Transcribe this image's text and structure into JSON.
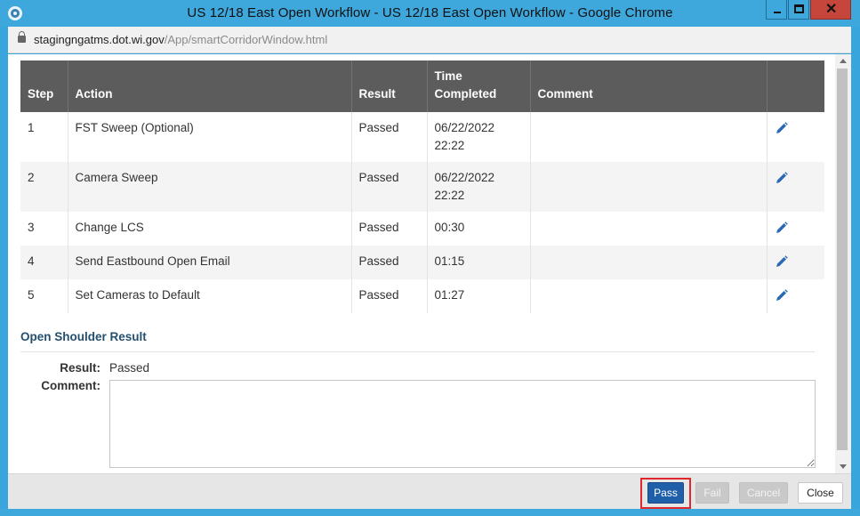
{
  "window": {
    "title": "US 12/18 East Open Workflow - US 12/18 East Open Workflow - Google Chrome"
  },
  "address": {
    "host": "stagingngatms.dot.wi.gov",
    "path": "/App/smartCorridorWindow.html"
  },
  "table": {
    "headers": {
      "step": "Step",
      "action": "Action",
      "result": "Result",
      "time_line1": "Time",
      "time_line2": "Completed",
      "comment": "Comment"
    },
    "rows": [
      {
        "step": "1",
        "action": "FST Sweep (Optional)",
        "result": "Passed",
        "time_line1": "06/22/2022",
        "time_line2": "22:22",
        "comment": ""
      },
      {
        "step": "2",
        "action": "Camera Sweep",
        "result": "Passed",
        "time_line1": "06/22/2022",
        "time_line2": "22:22",
        "comment": ""
      },
      {
        "step": "3",
        "action": "Change LCS",
        "result": "Passed",
        "time_line1": "00:30",
        "time_line2": "",
        "comment": ""
      },
      {
        "step": "4",
        "action": "Send Eastbound Open Email",
        "result": "Passed",
        "time_line1": "01:15",
        "time_line2": "",
        "comment": ""
      },
      {
        "step": "5",
        "action": "Set Cameras to Default",
        "result": "Passed",
        "time_line1": "01:27",
        "time_line2": "",
        "comment": ""
      }
    ],
    "edit_icon": "pencil-icon"
  },
  "result_section": {
    "title": "Open Shoulder Result",
    "result_label": "Result:",
    "result_value": "Passed",
    "comment_label": "Comment:",
    "comment_value": ""
  },
  "footer": {
    "pass_label": "Pass",
    "fail_label": "Fail",
    "cancel_label": "Cancel",
    "close_label": "Close"
  },
  "colors": {
    "window_frame": "#3ea8dc",
    "table_header": "#5c5c5c",
    "section_title": "#244f6f",
    "pass_button": "#1f5ea8",
    "highlight": "#e0262e",
    "edit_icon": "#2a6ab5"
  }
}
